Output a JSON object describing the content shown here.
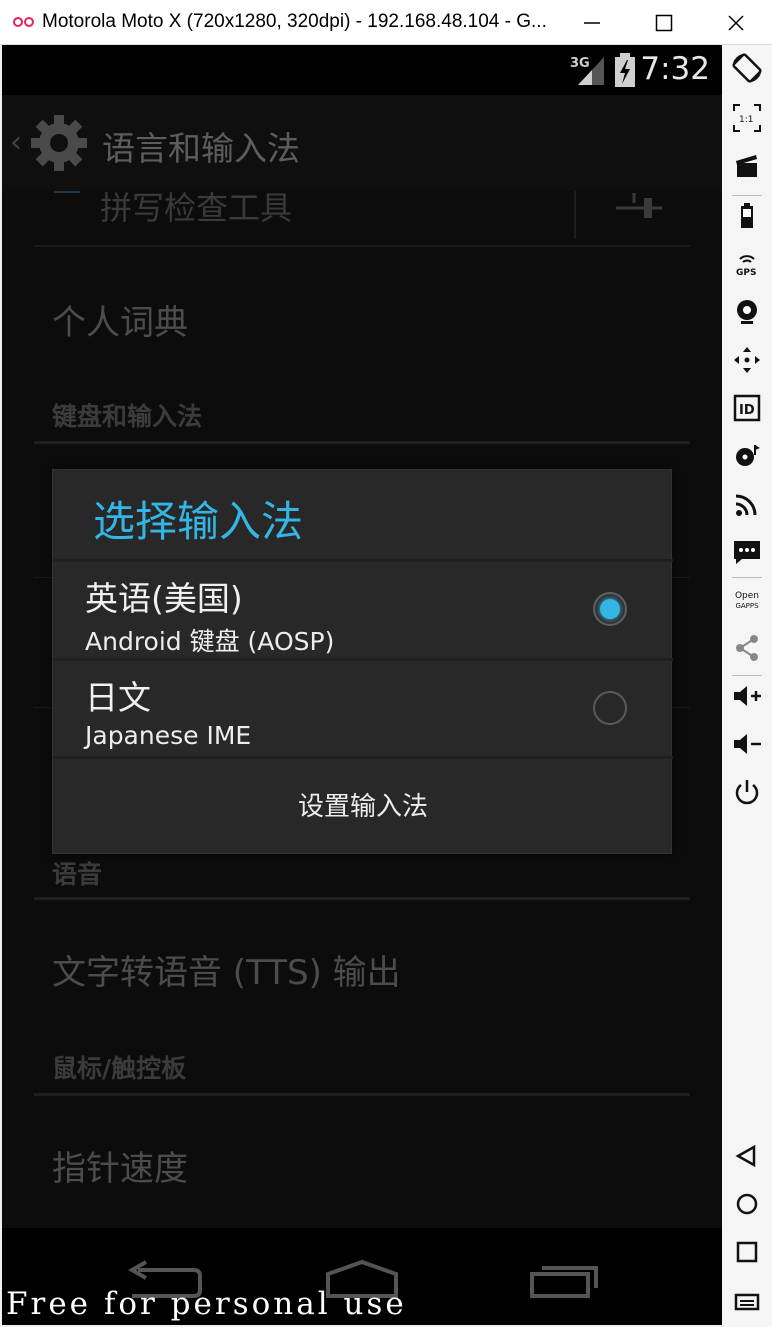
{
  "window": {
    "title": "Motorola Moto X (720x1280, 320dpi) - 192.168.48.104 - G...",
    "minimize_icon": "minimize-icon",
    "maximize_icon": "maximize-icon",
    "close_icon": "close-icon"
  },
  "statusbar": {
    "network": "3G",
    "time": "7:32"
  },
  "actionbar": {
    "title": "语言和输入法"
  },
  "settings": {
    "partial_item": "拼写检查工具",
    "personal_dictionary": "个人词典",
    "keyboard_section": "键盘和输入法",
    "voice_section": "语音",
    "tts_output": "文字转语音 (TTS) 输出",
    "mouse_section": "鼠标/触控板",
    "pointer_speed": "指针速度"
  },
  "dialog": {
    "title": "选择输入法",
    "options": [
      {
        "name": "英语(美国)",
        "sub": "Android 键盘 (AOSP)",
        "selected": true
      },
      {
        "name": "日文",
        "sub": "Japanese IME",
        "selected": false
      }
    ],
    "button": "设置输入法",
    "accent_color": "#33b5e5"
  },
  "sidebar": {
    "items": [
      "rotate-icon",
      "scale-icon",
      "video-capture-icon",
      "battery-icon",
      "gps-icon",
      "camera-icon",
      "dpad-icon",
      "device-id-icon",
      "disk-icon",
      "cast-icon",
      "sms-icon",
      "open-gapps-icon",
      "share-icon",
      "volume-up-icon",
      "volume-down-icon",
      "power-icon",
      "back-icon",
      "home-icon",
      "recents-icon",
      "menu-icon"
    ],
    "open_gapps_label_1": "Open",
    "open_gapps_label_2": "GAPPS",
    "gps_label": "GPS",
    "id_label": "ID"
  },
  "watermark": "Free for personal use"
}
